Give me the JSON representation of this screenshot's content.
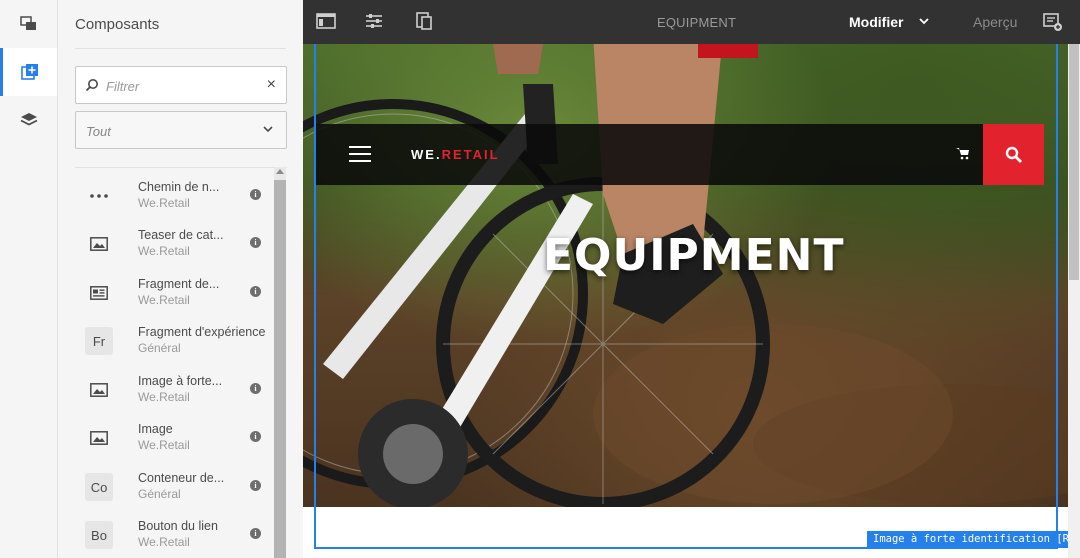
{
  "sidebar": {
    "title": "Composants",
    "filter_placeholder": "Filtrer",
    "group_select": "Tout",
    "items": [
      {
        "name": "Chemin de n...",
        "group": "We.Retail",
        "thumb": "more-icon",
        "info": true
      },
      {
        "name": "Teaser de cat...",
        "group": "We.Retail",
        "thumb": "image-icon",
        "info": true
      },
      {
        "name": "Fragment de...",
        "group": "We.Retail",
        "thumb": "fragment-icon",
        "info": true
      },
      {
        "name": "Fragment d'expérience",
        "group": "Général",
        "thumb_text": "Fr",
        "info": false
      },
      {
        "name": "Image à forte...",
        "group": "We.Retail",
        "thumb": "image-icon",
        "info": true
      },
      {
        "name": "Image",
        "group": "We.Retail",
        "thumb": "image-icon",
        "info": true
      },
      {
        "name": "Conteneur de...",
        "group": "Général",
        "thumb_text": "Co",
        "info": true
      },
      {
        "name": "Bouton du lien",
        "group": "We.Retail",
        "thumb_text": "Bo",
        "info": true
      }
    ]
  },
  "toolbar": {
    "page_title": "EQUIPMENT",
    "mode_label": "Modifier",
    "preview_label": "Aperçu"
  },
  "page": {
    "brand_prefix": "WE.",
    "brand_suffix": "RETAIL",
    "hero_title": "EQUIPMENT",
    "component_label": "Image à forte identification [Racine]"
  },
  "colors": {
    "accent": "#2680eb",
    "brand_red": "#e2222d",
    "topbar": "#323232"
  }
}
